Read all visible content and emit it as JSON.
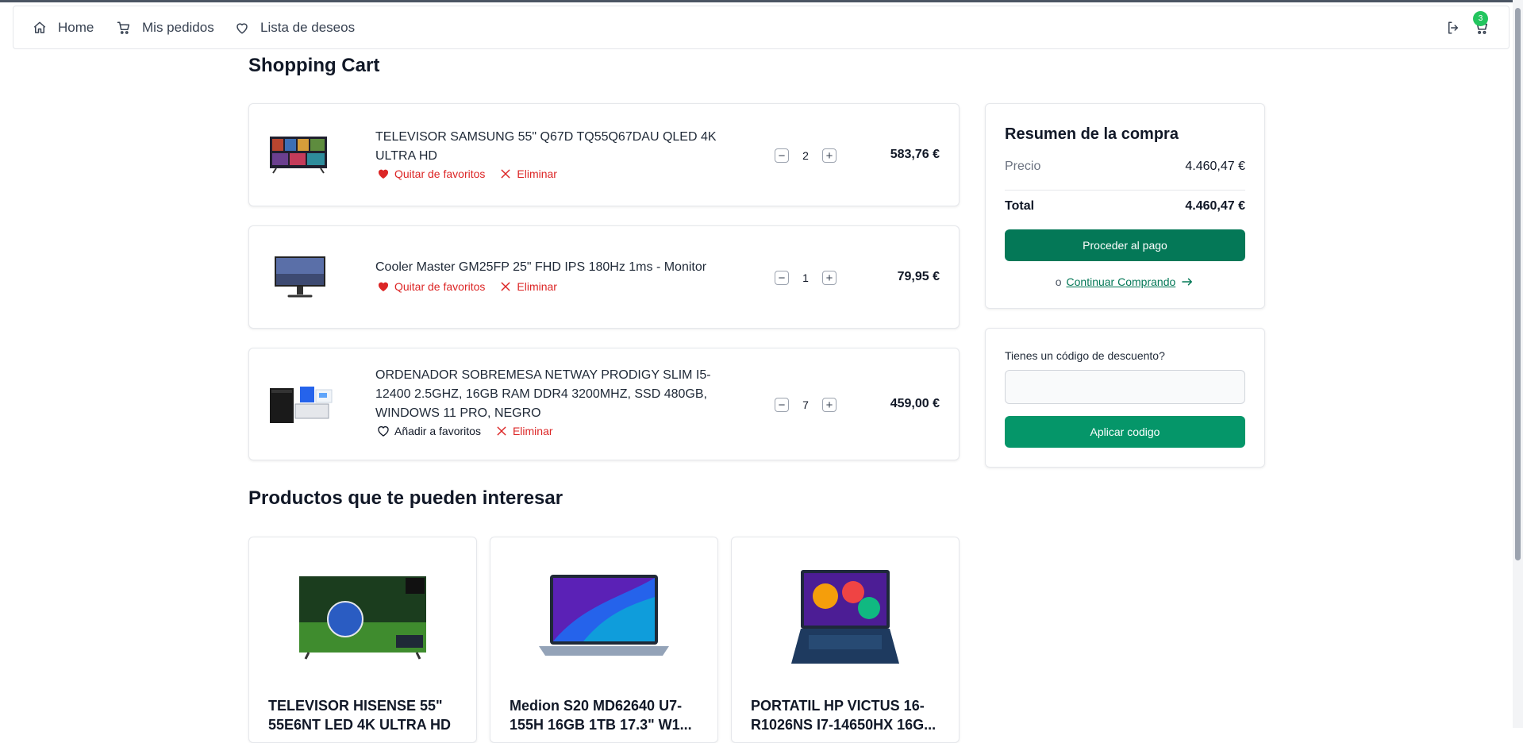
{
  "nav": {
    "home": "Home",
    "orders": "Mis pedidos",
    "wishlist": "Lista de deseos",
    "cart_count": "3"
  },
  "page_title": "Shopping Cart",
  "cart_items": [
    {
      "name": "TELEVISOR SAMSUNG 55\" Q67D TQ55Q67DAU QLED 4K ULTRA HD",
      "favorite_label": "Quitar de favoritos",
      "favorited": true,
      "remove_label": "Eliminar",
      "quantity": "2",
      "price": "583,76 €",
      "image_icon": "tv-thumbnail"
    },
    {
      "name": "Cooler Master GM25FP 25\" FHD IPS 180Hz 1ms - Monitor",
      "favorite_label": "Quitar de favoritos",
      "favorited": true,
      "remove_label": "Eliminar",
      "quantity": "1",
      "price": "79,95 €",
      "image_icon": "monitor-thumbnail"
    },
    {
      "name": "ORDENADOR SOBREMESA NETWAY PRODIGY SLIM I5-12400 2.5GHZ, 16GB RAM DDR4 3200MHZ, SSD 480GB, WINDOWS 11 PRO, NEGRO",
      "favorite_label": "Añadir a favoritos",
      "favorited": false,
      "remove_label": "Eliminar",
      "quantity": "7",
      "price": "459,00 €",
      "image_icon": "desktop-pc-thumbnail"
    }
  ],
  "summary": {
    "title": "Resumen de la compra",
    "price_label": "Precio",
    "price_value": "4.460,47 €",
    "total_label": "Total",
    "total_value": "4.460,47 €",
    "checkout_label": "Proceder al pago",
    "or_label": "o",
    "continue_label": "Continuar Comprando"
  },
  "discount": {
    "label": "Tienes un código de descuento?",
    "input_value": "",
    "apply_label": "Aplicar codigo"
  },
  "recommendations": {
    "title": "Productos que te pueden interesar",
    "items": [
      {
        "line1": "TELEVISOR HISENSE 55\"",
        "line2": "55E6NT LED 4K ULTRA HD",
        "image_icon": "tv-thumbnail"
      },
      {
        "line1": "Medion S20 MD62640 U7-",
        "line2": "155H 16GB 1TB 17.3\" W1...",
        "image_icon": "laptop-thumbnail"
      },
      {
        "line1": "PORTATIL HP VICTUS 16-",
        "line2": "R1026NS I7-14650HX 16G...",
        "image_icon": "gaming-laptop-thumbnail"
      }
    ]
  },
  "colors": {
    "accent_green": "#047857",
    "apply_green": "#059669",
    "danger_red": "#dc2626",
    "badge_green": "#22c55e"
  }
}
